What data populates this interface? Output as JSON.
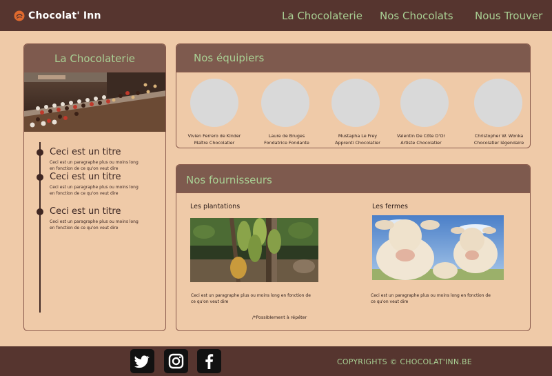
{
  "header": {
    "brand": "Chocolat' Inn",
    "logo_icon": "chocolate-drop-icon",
    "nav": [
      {
        "label": "La Chocolaterie"
      },
      {
        "label": "Nos Chocolats"
      },
      {
        "label": "Nous Trouver"
      }
    ]
  },
  "sidebar": {
    "title": "La Chocolaterie",
    "image": "chocolate-display-photo",
    "timeline": [
      {
        "title": "Ceci est un titre",
        "text": "Ceci est un paragraphe plus ou moins long en fonction de ce qu'on veut dire"
      },
      {
        "title": "Ceci est un titre",
        "text": "Ceci est un paragraphe plus ou moins long en fonction de ce qu'on veut dire"
      },
      {
        "title": "Ceci est un titre",
        "text": "Ceci est un paragraphe plus ou moins long en fonction de ce qu'on veut dire"
      }
    ]
  },
  "team": {
    "title": "Nos équipiers",
    "members": [
      {
        "name": "Vivien Ferrero de Kinder",
        "role": "Maître Chocolatier"
      },
      {
        "name": "Laure de Bruges",
        "role": "Fondatrice Fondante"
      },
      {
        "name": "Mustapha Le Frey",
        "role": "Apprenti Chocolatier"
      },
      {
        "name": "Valentin De Côte D'Or",
        "role": "Artiste Chocolatier"
      },
      {
        "name": "Christopher W. Wonka",
        "role": "Chocolatier légendaire"
      }
    ]
  },
  "suppliers": {
    "title": "Nos fournisseurs",
    "items": [
      {
        "title": "Les plantations",
        "image": "cacao-pods-photo",
        "text": "Ceci est un paragraphe plus ou moins long en fonction de ce qu'on veut dire"
      },
      {
        "title": "Les fermes",
        "image": "cows-photo",
        "text": "Ceci est un paragraphe plus ou moins long en fonction de ce qu'on veut dire"
      }
    ],
    "note": "/*Possiblement à répéter"
  },
  "footer": {
    "social": [
      "twitter-icon",
      "instagram-icon",
      "facebook-icon"
    ],
    "copyright": "COPYRIGHTS © CHOCOLAT'INN.BE"
  },
  "colors": {
    "header_bg": "#56352f",
    "page_bg": "#efcaa8",
    "card_header_bg": "#7e5a4e",
    "accent_green": "#a9d094",
    "avatar_placeholder": "#d9d9d9"
  }
}
